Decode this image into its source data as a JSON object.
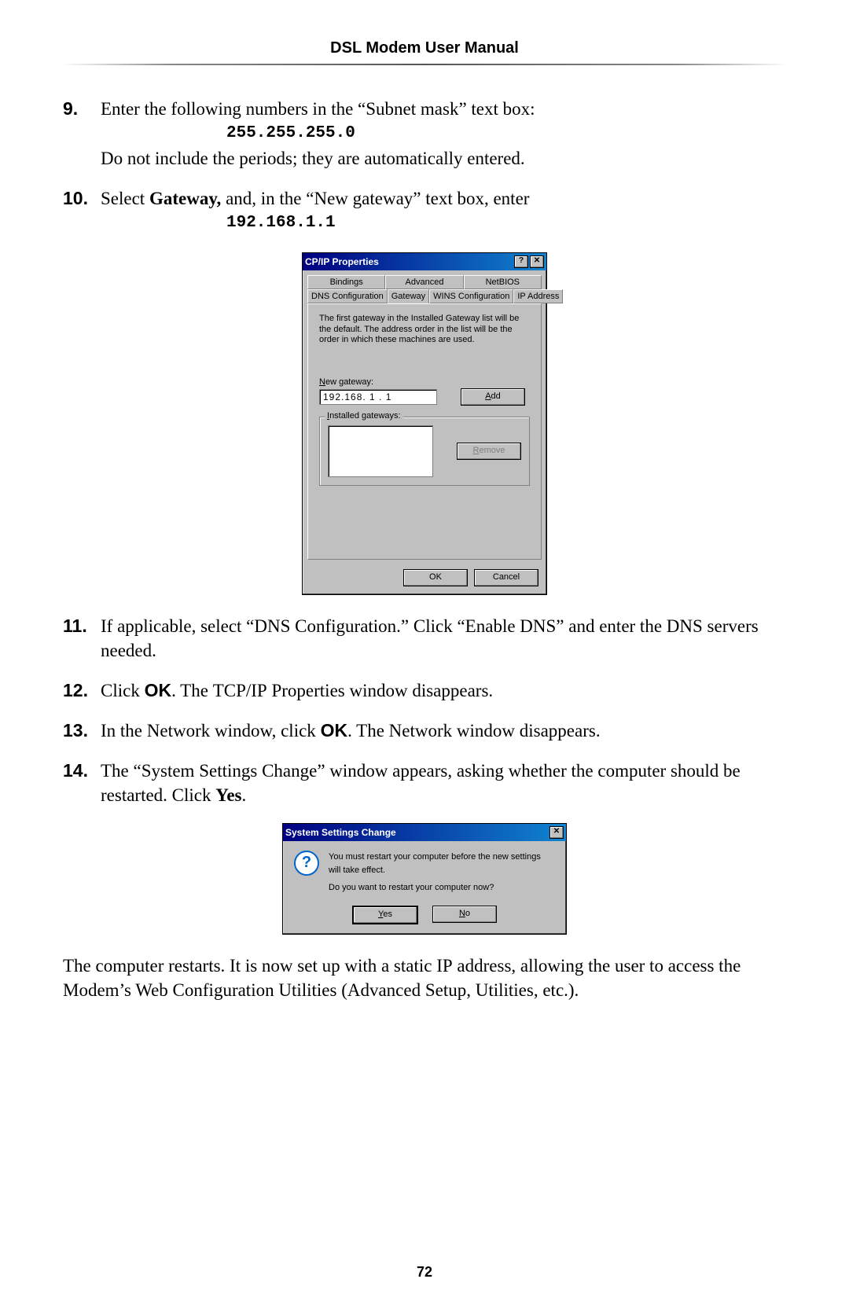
{
  "header": {
    "title": "DSL Modem User Manual"
  },
  "steps": {
    "s9": {
      "num": "9.",
      "line1": "Enter the following numbers in the “Subnet mask” text box:",
      "code": "255.255.255.0",
      "line2": "Do not include the periods; they are automatically entered."
    },
    "s10": {
      "num": "10.",
      "line1_pre": "Select ",
      "line1_bold": "Gateway,",
      "line1_post": " and, in the “New gateway” text box, enter",
      "code": "192.168.1.1"
    },
    "s11": {
      "num": "11.",
      "text": "If applicable, select “DNS Configuration.” Click “Enable DNS” and enter the DNS servers needed."
    },
    "s12": {
      "num": "12.",
      "pre": "Click ",
      "ok": "OK",
      "post1": ". The ",
      "tcpip": "TCP/IP",
      "post2": " Properties window disappears."
    },
    "s13": {
      "num": "13.",
      "pre": "In the Network window, click ",
      "ok": "OK",
      "post": ". The Network window disappears."
    },
    "s14": {
      "num": "14.",
      "pre": "The “System Settings Change” window appears, asking whether the computer should be restarted. Click ",
      "yes": "Yes",
      "post": "."
    }
  },
  "dialog1": {
    "title": "CP/IP Properties",
    "help": "?",
    "close": "✕",
    "tabs_top": {
      "bindings": "Bindings",
      "advanced": "Advanced",
      "netbios": "NetBIOS"
    },
    "tabs_bottom": {
      "dns": "DNS Configuration",
      "gateway": "Gateway",
      "wins": "WINS Configuration",
      "ip": "IP Address"
    },
    "panel_text": "The first gateway in the Installed Gateway list will be the default. The address order in the list will be the order in which these machines are used.",
    "new_gateway_label_pre": "N",
    "new_gateway_label_u": "ew gateway:",
    "ip_value": "192.168. 1 . 1",
    "add_pre": "",
    "add_u": "A",
    "add_post": "dd",
    "installed_label_pre": "",
    "installed_label_u": "I",
    "installed_label_post": "nstalled gateways:",
    "remove_pre": "",
    "remove_u": "R",
    "remove_post": "emove",
    "ok": "OK",
    "cancel": "Cancel"
  },
  "dialog2": {
    "title": "System Settings Change",
    "close": "✕",
    "q": "?",
    "line1": "You must restart your computer before the new settings will take effect.",
    "line2": "Do you want to restart your computer now?",
    "yes_u": "Y",
    "yes_post": "es",
    "no_u": "N",
    "no_post": "o"
  },
  "final": {
    "pre": "The computer restarts. It is now set up with a static ",
    "ip": "IP",
    "post": " address, allowing the user to access the Modem’s Web Configuration Utilities (Advanced Setup, Utilities, etc.)."
  },
  "page_number": "72"
}
